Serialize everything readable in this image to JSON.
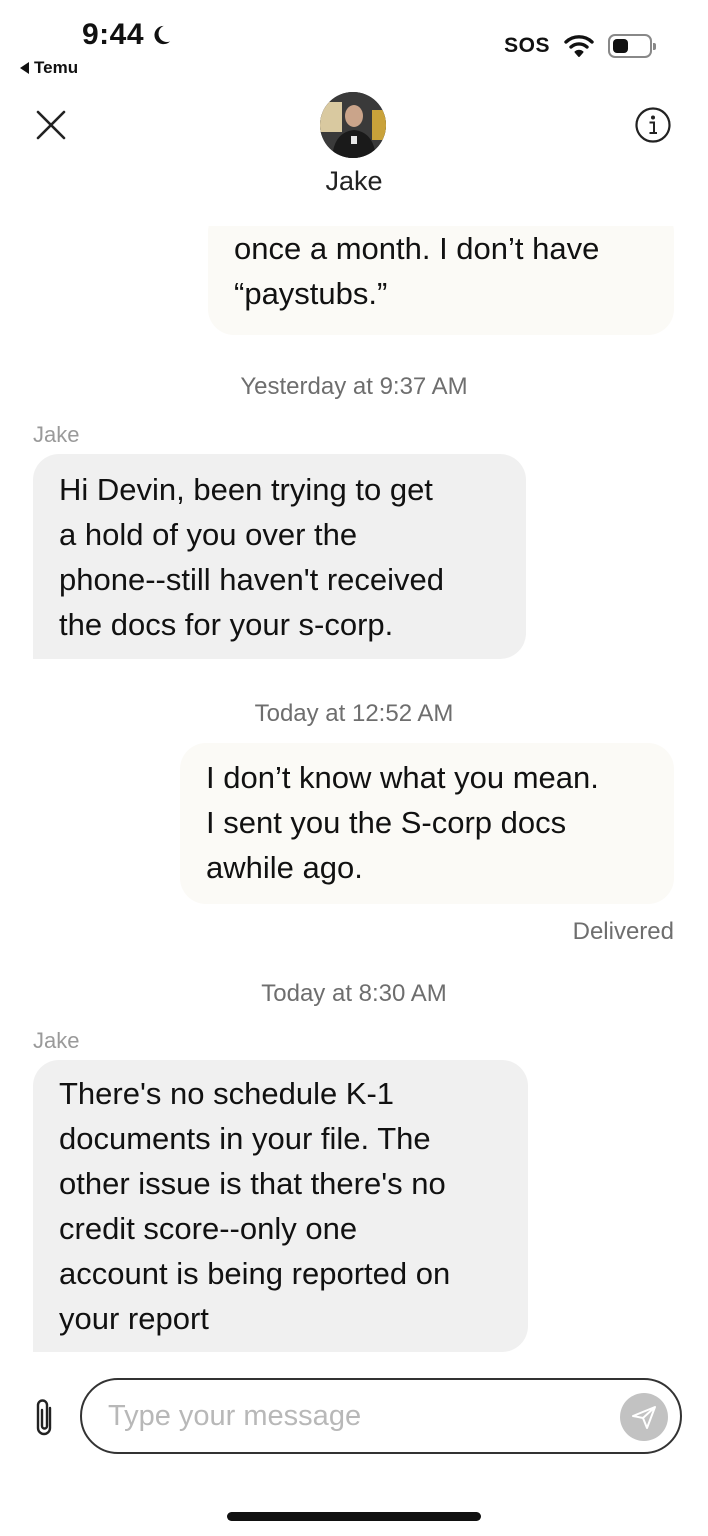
{
  "status_bar": {
    "time": "9:44",
    "back_app": "Temu",
    "sos": "SOS",
    "battery_level": 0.45
  },
  "header": {
    "contact_name": "Jake"
  },
  "messages": [
    {
      "type": "outgoing",
      "lines": [
        "once a month. I don’t have",
        "“paystubs.”"
      ]
    },
    {
      "type": "timestamp",
      "text": "Yesterday at 9:37 AM"
    },
    {
      "type": "sender",
      "text": "Jake"
    },
    {
      "type": "incoming",
      "lines": [
        "Hi Devin, been trying to get",
        "a hold of you over the",
        "phone--still haven't received",
        "the docs for your s-corp."
      ]
    },
    {
      "type": "timestamp",
      "text": "Today at 12:52 AM"
    },
    {
      "type": "outgoing",
      "lines": [
        "I don’t know what you mean.",
        "I sent you the S-corp docs",
        "awhile ago."
      ]
    },
    {
      "type": "status",
      "text": "Delivered"
    },
    {
      "type": "timestamp",
      "text": "Today at 8:30 AM"
    },
    {
      "type": "sender",
      "text": "Jake"
    },
    {
      "type": "incoming",
      "lines": [
        "There's no schedule K-1",
        "documents in your file. The",
        "other issue is that there's no",
        "credit score--only one",
        "account is being reported on",
        "your report"
      ]
    }
  ],
  "composer": {
    "placeholder": "Type your message",
    "value": ""
  },
  "colors": {
    "outgoing_bubble": "#fbfaf6",
    "incoming_bubble": "#f0f0f0",
    "send_button": "#c2c2c2"
  }
}
